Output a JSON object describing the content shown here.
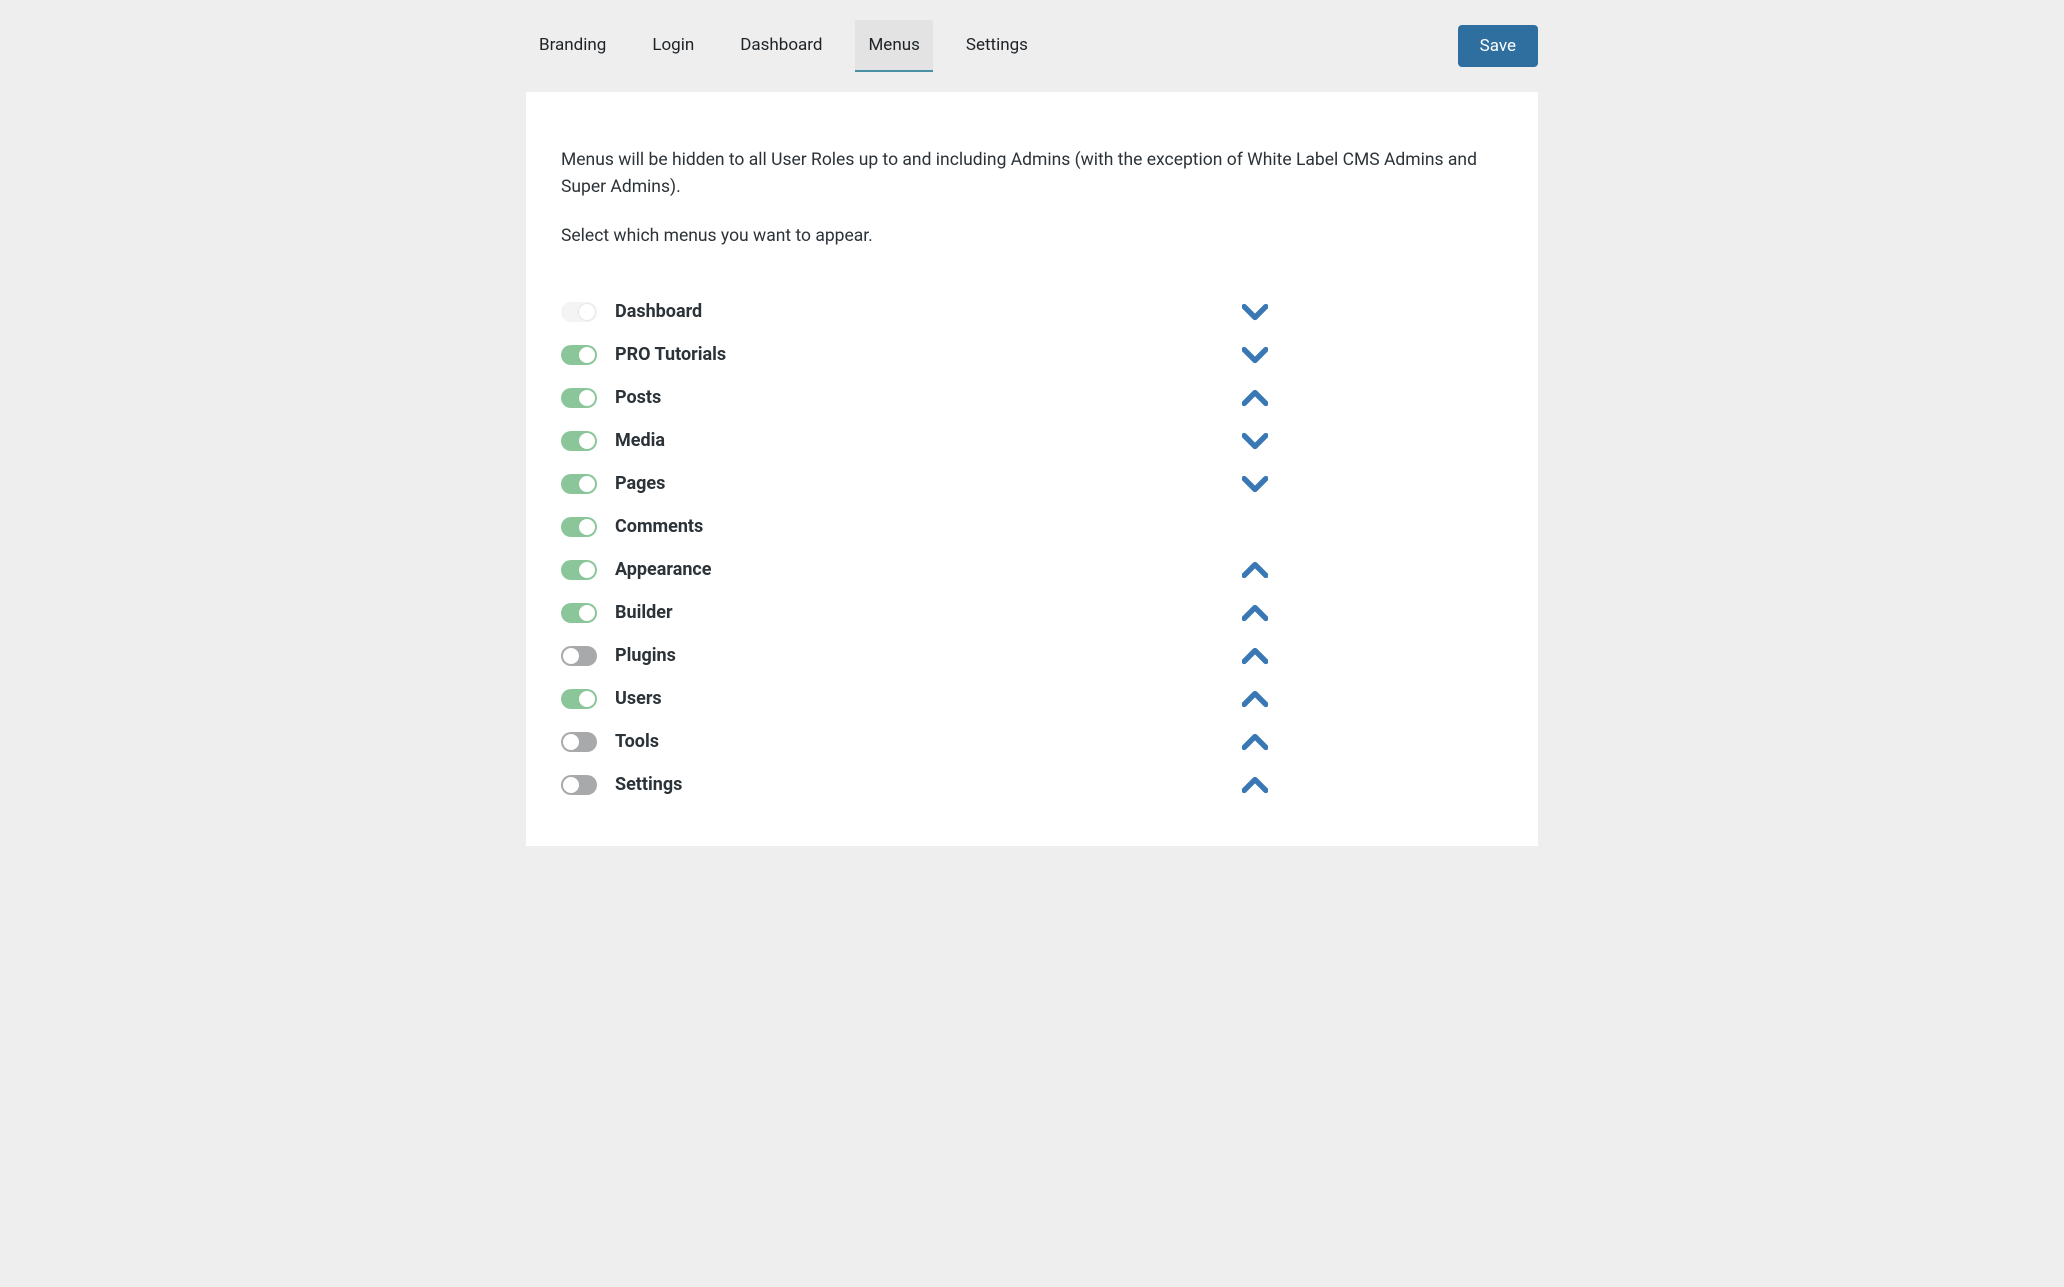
{
  "tabs": [
    {
      "label": "Branding",
      "active": false
    },
    {
      "label": "Login",
      "active": false
    },
    {
      "label": "Dashboard",
      "active": false
    },
    {
      "label": "Menus",
      "active": true
    },
    {
      "label": "Settings",
      "active": false
    }
  ],
  "save_label": "Save",
  "description_line1": "Menus will be hidden to all User Roles up to and including Admins (with the exception of White Label CMS Admins and Super Admins).",
  "description_line2": "Select which menus you want to appear.",
  "menus": [
    {
      "label": "Dashboard",
      "toggle": "off-light",
      "chevron": "down"
    },
    {
      "label": "PRO Tutorials",
      "toggle": "on-green",
      "chevron": "down"
    },
    {
      "label": "Posts",
      "toggle": "on-green",
      "chevron": "up"
    },
    {
      "label": "Media",
      "toggle": "on-green",
      "chevron": "down"
    },
    {
      "label": "Pages",
      "toggle": "on-green",
      "chevron": "down"
    },
    {
      "label": "Comments",
      "toggle": "on-green",
      "chevron": null
    },
    {
      "label": "Appearance",
      "toggle": "on-green",
      "chevron": "up"
    },
    {
      "label": "Builder",
      "toggle": "on-green",
      "chevron": "up"
    },
    {
      "label": "Plugins",
      "toggle": "off-grey",
      "chevron": "up"
    },
    {
      "label": "Users",
      "toggle": "on-green",
      "chevron": "up"
    },
    {
      "label": "Tools",
      "toggle": "off-grey",
      "chevron": "up"
    },
    {
      "label": "Settings",
      "toggle": "off-grey",
      "chevron": "up"
    }
  ],
  "colors": {
    "accent_blue": "#2f6f9f",
    "chevron_blue": "#3a78b5",
    "toggle_green": "#8bc69b",
    "toggle_grey": "#a7a9ab",
    "bg": "#eeeeee",
    "panel_bg": "#ffffff"
  }
}
